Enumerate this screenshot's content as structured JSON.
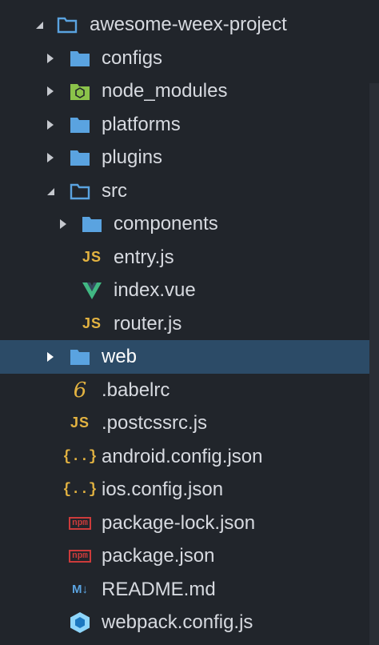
{
  "explorer": {
    "project_name": "awesome-weex-project",
    "colors": {
      "background": "#21252b",
      "selected_row": "#2c4b67",
      "folder_icon": "#5aa3e0",
      "js_icon": "#e3b341",
      "vue_icon": "#41b883",
      "npm_icon": "#cc3b3b",
      "node_modules_icon": "#8bc34a"
    },
    "items": [
      {
        "label": "configs",
        "icon": "folder-icon"
      },
      {
        "label": "node_modules",
        "icon": "node-folder-icon"
      },
      {
        "label": "platforms",
        "icon": "folder-icon"
      },
      {
        "label": "plugins",
        "icon": "folder-icon"
      },
      {
        "label": "src",
        "icon": "folder-open-icon"
      },
      {
        "label": "components",
        "icon": "folder-icon"
      },
      {
        "label": "entry.js",
        "icon": "js-icon",
        "icon_text": "JS"
      },
      {
        "label": "index.vue",
        "icon": "vue-icon"
      },
      {
        "label": "router.js",
        "icon": "js-icon",
        "icon_text": "JS"
      },
      {
        "label": "web",
        "icon": "folder-icon",
        "selected": true
      },
      {
        "label": ".babelrc",
        "icon": "babel-icon",
        "icon_text": "6"
      },
      {
        "label": ".postcssrc.js",
        "icon": "js-icon",
        "icon_text": "JS"
      },
      {
        "label": "android.config.json",
        "icon": "json-icon",
        "icon_text": "{..}"
      },
      {
        "label": "ios.config.json",
        "icon": "json-icon",
        "icon_text": "{..}"
      },
      {
        "label": "package-lock.json",
        "icon": "npm-icon",
        "icon_text": "npm"
      },
      {
        "label": "package.json",
        "icon": "npm-icon",
        "icon_text": "npm"
      },
      {
        "label": "README.md",
        "icon": "markdown-icon",
        "icon_text": "M↓"
      },
      {
        "label": "webpack.config.js",
        "icon": "webpack-icon"
      }
    ]
  }
}
